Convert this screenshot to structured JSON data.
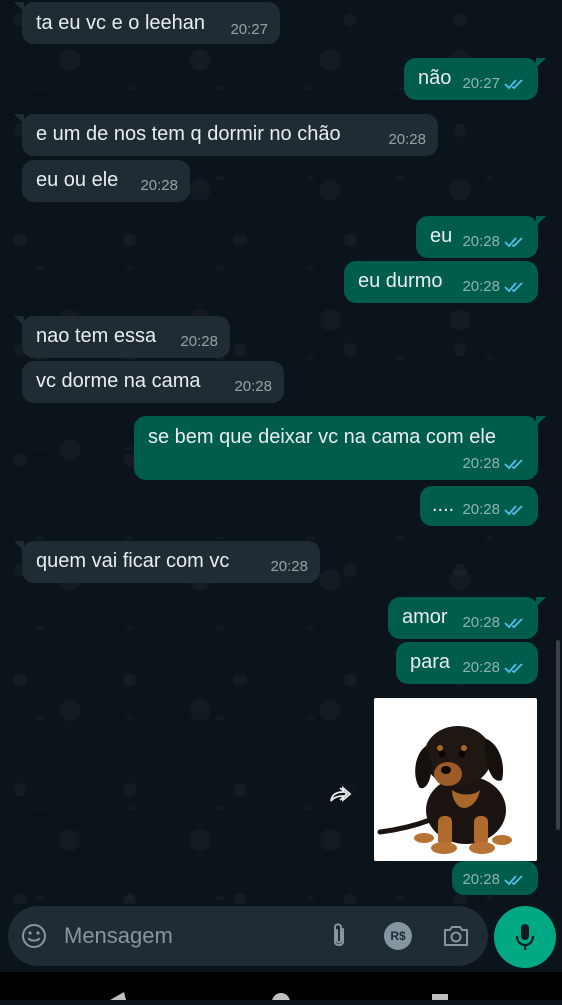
{
  "colors": {
    "incoming": "#202c33",
    "outgoing": "#005c4b",
    "accent": "#00a884",
    "read_ticks": "#53bdeb"
  },
  "messages": [
    {
      "direction": "in",
      "text": "ta eu vc e o leehan",
      "time": "20:27"
    },
    {
      "direction": "out",
      "text": "não",
      "time": "20:27",
      "status": "read"
    },
    {
      "direction": "in",
      "text": "e um de nos tem q dormir no chão",
      "time": "20:28"
    },
    {
      "direction": "in",
      "text": "eu ou ele",
      "time": "20:28"
    },
    {
      "direction": "out",
      "text": "eu",
      "time": "20:28",
      "status": "read"
    },
    {
      "direction": "out",
      "text": "eu durmo",
      "time": "20:28",
      "status": "read"
    },
    {
      "direction": "in",
      "text": "nao tem essa",
      "time": "20:28"
    },
    {
      "direction": "in",
      "text": "vc dorme na cama",
      "time": "20:28"
    },
    {
      "direction": "out",
      "text": "se bem que deixar vc na cama com ele",
      "time": "20:28",
      "status": "read"
    },
    {
      "direction": "out",
      "text": "....",
      "time": "20:28",
      "status": "read"
    },
    {
      "direction": "in",
      "text": "quem vai ficar com vc",
      "time": "20:28"
    },
    {
      "direction": "out",
      "text": "amor",
      "time": "20:28",
      "status": "read"
    },
    {
      "direction": "out",
      "text": "para",
      "time": "20:28",
      "status": "read"
    },
    {
      "direction": "out",
      "type": "image",
      "image_subject": "puppy",
      "time": "20:28",
      "status": "read"
    }
  ],
  "composer": {
    "placeholder": "Mensagem",
    "icons": [
      "emoji-icon",
      "attach-icon",
      "payment-icon",
      "camera-icon",
      "mic-icon"
    ],
    "payment_label": "R$"
  },
  "icons": {
    "forward": "forward-icon",
    "nav": [
      "back-icon",
      "home-icon",
      "recents-icon"
    ]
  }
}
